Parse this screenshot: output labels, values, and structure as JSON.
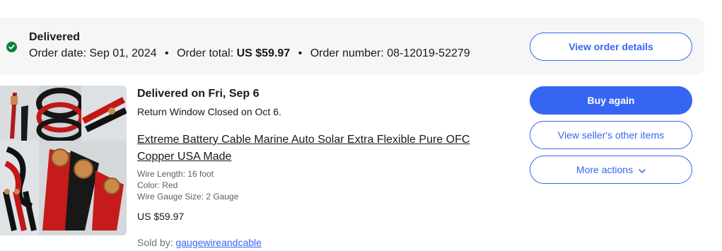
{
  "order": {
    "status": "Delivered",
    "order_date_label": "Order date:",
    "order_date": "Sep 01, 2024",
    "order_total_label": "Order total:",
    "order_total": "US $59.97",
    "order_number_label": "Order number:",
    "order_number": "08-12019-52279",
    "separator": "•",
    "view_details_label": "View order details"
  },
  "item": {
    "delivered_on": "Delivered on Fri, Sep 6",
    "return_window": "Return Window Closed on Oct 6.",
    "title": "Extreme Battery Cable Marine Auto Solar Extra Flexible Pure OFC Copper USA Made",
    "aspects": [
      "Wire Length: 16 foot",
      "Color: Red",
      "Wire Gauge Size: 2 Gauge"
    ],
    "price": "US $59.97",
    "sold_by_label": "Sold by:",
    "seller": "gaugewireandcable",
    "image_icon": "product-photo-battery-cables"
  },
  "actions": {
    "buy_again": "Buy again",
    "view_seller_items": "View seller's other items",
    "more_actions": "More actions"
  },
  "colors": {
    "accent": "#3665f3",
    "success": "#05823f",
    "header_bg": "#f6f6f7"
  }
}
